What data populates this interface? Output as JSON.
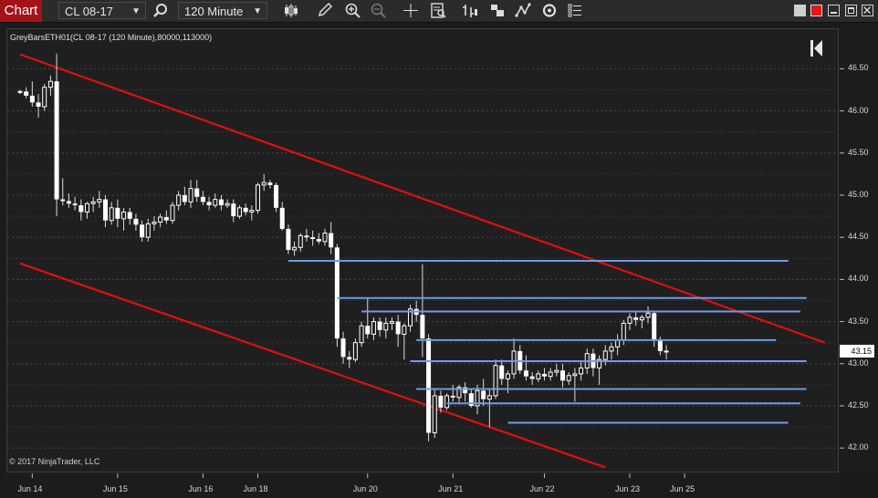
{
  "toolbar": {
    "chart_tab": "Chart",
    "instrument": "CL 08-17",
    "interval": "120 Minute"
  },
  "chart": {
    "info_label": "GreyBarsETH01(CL 08-17 (120 Minute),80000,113000)",
    "copyright": "© 2017 NinjaTrader, LLC",
    "last_price": "43.15"
  },
  "colors": {
    "background": "#1f1f1f",
    "channel_line": "#e01010",
    "level_line": "#6f9bea",
    "bar_up": "#ffffff",
    "bar_down": "#ffffff",
    "title_tab": "#a3141a"
  },
  "chart_data": {
    "type": "candlestick",
    "y_ticks": [
      "46.50",
      "46.00",
      "45.50",
      "45.00",
      "44.50",
      "44.00",
      "43.50",
      "43.00",
      "42.50",
      "42.00"
    ],
    "ylim": [
      41.71,
      46.98
    ],
    "x_ticks": [
      "Jun 14",
      "Jun 15",
      "Jun 16",
      "Jun 18",
      "Jun 20",
      "Jun 21",
      "Jun 22",
      "Jun 23",
      "Jun 25"
    ],
    "candles": [
      [
        46.22,
        46.25,
        46.2,
        46.23
      ],
      [
        46.23,
        46.28,
        46.15,
        46.18
      ],
      [
        46.18,
        46.35,
        46.05,
        46.1
      ],
      [
        46.1,
        46.2,
        45.92,
        46.05
      ],
      [
        46.05,
        46.32,
        46.0,
        46.28
      ],
      [
        46.28,
        46.42,
        46.18,
        46.35
      ],
      [
        46.35,
        46.68,
        44.75,
        44.95
      ],
      [
        44.95,
        45.2,
        44.88,
        44.93
      ],
      [
        44.93,
        45.02,
        44.85,
        44.9
      ],
      [
        44.9,
        44.98,
        44.82,
        44.88
      ],
      [
        44.88,
        44.95,
        44.7,
        44.8
      ],
      [
        44.8,
        44.92,
        44.72,
        44.9
      ],
      [
        44.9,
        44.98,
        44.8,
        44.92
      ],
      [
        44.92,
        45.05,
        44.85,
        44.95
      ],
      [
        44.95,
        45.0,
        44.62,
        44.7
      ],
      [
        44.7,
        44.92,
        44.65,
        44.85
      ],
      [
        44.85,
        44.95,
        44.62,
        44.72
      ],
      [
        44.72,
        44.85,
        44.58,
        44.8
      ],
      [
        44.8,
        44.85,
        44.65,
        44.72
      ],
      [
        44.72,
        44.78,
        44.58,
        44.65
      ],
      [
        44.65,
        44.7,
        44.45,
        44.5
      ],
      [
        44.5,
        44.72,
        44.45,
        44.66
      ],
      [
        44.66,
        44.75,
        44.58,
        44.68
      ],
      [
        44.68,
        44.78,
        44.62,
        44.74
      ],
      [
        44.74,
        44.82,
        44.66,
        44.7
      ],
      [
        44.7,
        44.92,
        44.66,
        44.88
      ],
      [
        44.88,
        45.05,
        44.82,
        45.0
      ],
      [
        45.0,
        45.1,
        44.88,
        44.92
      ],
      [
        44.92,
        45.18,
        44.85,
        45.08
      ],
      [
        45.08,
        45.18,
        44.92,
        44.98
      ],
      [
        44.98,
        45.05,
        44.88,
        44.92
      ],
      [
        44.92,
        44.98,
        44.82,
        44.88
      ],
      [
        44.88,
        45.02,
        44.85,
        44.95
      ],
      [
        44.95,
        45.0,
        44.82,
        44.88
      ],
      [
        44.88,
        44.95,
        44.85,
        44.9
      ],
      [
        44.9,
        44.95,
        44.68,
        44.75
      ],
      [
        44.75,
        44.88,
        44.72,
        44.85
      ],
      [
        44.85,
        44.9,
        44.76,
        44.8
      ],
      [
        44.8,
        44.88,
        44.7,
        44.82
      ],
      [
        44.82,
        45.15,
        44.78,
        45.12
      ],
      [
        45.12,
        45.25,
        45.05,
        45.15
      ],
      [
        45.15,
        45.18,
        45.08,
        45.12
      ],
      [
        45.12,
        45.15,
        44.8,
        44.85
      ],
      [
        44.85,
        44.92,
        44.58,
        44.6
      ],
      [
        44.6,
        44.65,
        44.3,
        44.35
      ],
      [
        44.35,
        44.45,
        44.28,
        44.38
      ],
      [
        44.38,
        44.55,
        44.33,
        44.52
      ],
      [
        44.52,
        44.6,
        44.45,
        44.5
      ],
      [
        44.5,
        44.58,
        44.4,
        44.48
      ],
      [
        44.48,
        44.55,
        44.42,
        44.45
      ],
      [
        44.45,
        44.6,
        44.4,
        44.55
      ],
      [
        44.55,
        44.68,
        44.3,
        44.38
      ],
      [
        44.38,
        44.42,
        43.2,
        43.3
      ],
      [
        43.3,
        43.38,
        43.0,
        43.08
      ],
      [
        43.08,
        43.15,
        42.95,
        43.05
      ],
      [
        43.05,
        43.3,
        43.02,
        43.25
      ],
      [
        43.25,
        43.5,
        43.2,
        43.45
      ],
      [
        43.45,
        43.78,
        43.3,
        43.35
      ],
      [
        43.35,
        43.55,
        43.28,
        43.5
      ],
      [
        43.5,
        43.55,
        43.32,
        43.4
      ],
      [
        43.4,
        43.55,
        43.3,
        43.48
      ],
      [
        43.48,
        43.55,
        43.4,
        43.5
      ],
      [
        43.5,
        43.58,
        43.2,
        43.35
      ],
      [
        43.35,
        43.48,
        43.05,
        43.45
      ],
      [
        43.45,
        43.7,
        43.38,
        43.65
      ],
      [
        43.65,
        43.75,
        43.5,
        43.58
      ],
      [
        43.58,
        44.18,
        43.08,
        43.3
      ],
      [
        43.3,
        43.35,
        42.08,
        42.18
      ],
      [
        42.18,
        42.7,
        42.12,
        42.62
      ],
      [
        42.62,
        42.68,
        42.42,
        42.48
      ],
      [
        42.48,
        42.65,
        42.45,
        42.62
      ],
      [
        42.62,
        42.75,
        42.55,
        42.6
      ],
      [
        42.6,
        42.75,
        42.52,
        42.72
      ],
      [
        42.72,
        42.78,
        42.55,
        42.65
      ],
      [
        42.65,
        42.7,
        42.48,
        42.5
      ],
      [
        42.5,
        42.75,
        42.4,
        42.68
      ],
      [
        42.68,
        42.82,
        42.5,
        42.58
      ],
      [
        42.58,
        42.7,
        42.25,
        42.62
      ],
      [
        42.62,
        43.05,
        42.58,
        42.98
      ],
      [
        42.98,
        43.05,
        42.75,
        42.82
      ],
      [
        42.82,
        42.92,
        42.65,
        42.88
      ],
      [
        42.88,
        43.3,
        42.82,
        43.15
      ],
      [
        43.15,
        43.22,
        42.88,
        42.92
      ],
      [
        42.92,
        43.1,
        42.8,
        42.85
      ],
      [
        42.85,
        42.9,
        42.75,
        42.82
      ],
      [
        42.82,
        42.92,
        42.78,
        42.88
      ],
      [
        42.88,
        42.95,
        42.8,
        42.85
      ],
      [
        42.85,
        42.95,
        42.8,
        42.9
      ],
      [
        42.9,
        43.0,
        42.85,
        42.92
      ],
      [
        42.92,
        43.0,
        42.72,
        42.8
      ],
      [
        42.8,
        42.9,
        42.75,
        42.86
      ],
      [
        42.86,
        42.95,
        42.55,
        42.88
      ],
      [
        42.88,
        43.02,
        42.8,
        42.95
      ],
      [
        42.95,
        43.18,
        42.88,
        43.12
      ],
      [
        43.12,
        43.18,
        42.85,
        42.95
      ],
      [
        42.95,
        43.1,
        42.75,
        43.05
      ],
      [
        43.05,
        43.22,
        42.98,
        43.15
      ],
      [
        43.15,
        43.25,
        43.05,
        43.2
      ],
      [
        43.2,
        43.35,
        43.1,
        43.28
      ],
      [
        43.28,
        43.52,
        43.22,
        43.48
      ],
      [
        43.48,
        43.6,
        43.4,
        43.55
      ],
      [
        43.55,
        43.62,
        43.45,
        43.52
      ],
      [
        43.52,
        43.58,
        43.42,
        43.55
      ],
      [
        43.55,
        43.68,
        43.48,
        43.6
      ],
      [
        43.6,
        43.62,
        43.2,
        43.28
      ],
      [
        43.28,
        43.32,
        43.1,
        43.15
      ],
      [
        43.15,
        43.22,
        43.05,
        43.15
      ]
    ],
    "channel_lines": [
      {
        "from": [
          0,
          46.67
        ],
        "to": [
          132,
          43.25
        ]
      },
      {
        "from": [
          0,
          44.19
        ],
        "to": [
          96,
          41.77
        ]
      }
    ],
    "levels": [
      {
        "from": 44,
        "to": 126,
        "price": 44.22
      },
      {
        "from": 52,
        "to": 129,
        "price": 43.78
      },
      {
        "from": 56,
        "to": 128,
        "price": 43.62
      },
      {
        "from": 65,
        "to": 124,
        "price": 43.28
      },
      {
        "from": 64,
        "to": 129,
        "price": 43.03
      },
      {
        "from": 65,
        "to": 129,
        "price": 42.7
      },
      {
        "from": 70,
        "to": 128,
        "price": 42.53
      },
      {
        "from": 80,
        "to": 126,
        "price": 42.3
      }
    ]
  }
}
